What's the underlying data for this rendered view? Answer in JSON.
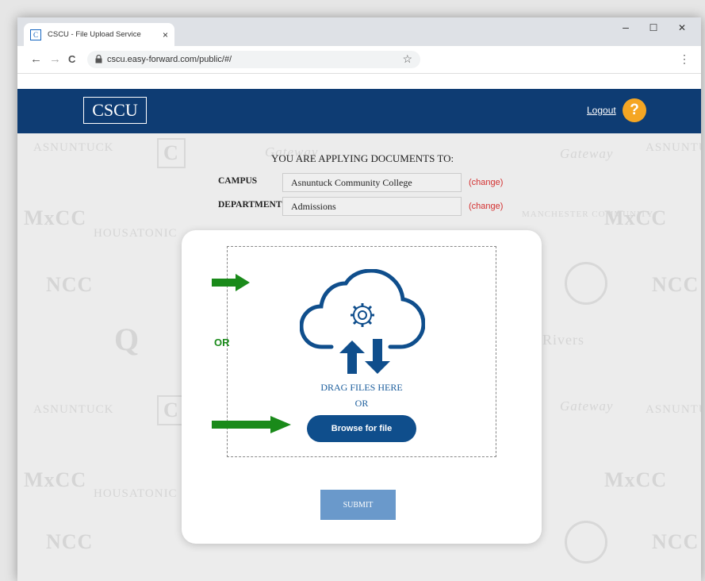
{
  "browser": {
    "tab_title": "CSCU - File Upload Service",
    "favicon_letter": "C",
    "tab_close": "×",
    "url": "cscu.easy-forward.com/public/#/",
    "minimize": "–",
    "maximize": "☐",
    "close": "✕",
    "back": "←",
    "forward": "→",
    "reload": "C",
    "bookmark": "☆",
    "menu": "⋮",
    "lock": "🔒"
  },
  "header": {
    "logo": "CSCU",
    "logout": "Logout",
    "help": "?"
  },
  "watermarks": [
    "ASNUNTUCK",
    "Gateway",
    "HOUSATONIC",
    "MANCHESTER COMMUNITY",
    "MxCC",
    "NCC",
    "Q",
    "Rivers",
    "CAPITAL"
  ],
  "applying": {
    "title": "YOU ARE APPLYING DOCUMENTS TO:",
    "campus_label": "CAMPUS",
    "campus_value": "Asnuntuck Community College",
    "department_label": "DEPARTMENT",
    "department_value": "Admissions",
    "change_label": "(change)"
  },
  "upload": {
    "drag_text": "DRAG FILES HERE",
    "or_text": "OR",
    "browse_label": "Browse for file",
    "submit_label": "SUBMIT"
  },
  "annotation": {
    "or_label": "OR",
    "arrow_color": "#1a8a1a"
  },
  "colors": {
    "header_bg": "#0e3c73",
    "accent": "#0f4e8c",
    "help_badge": "#f5a623",
    "change_link": "#d32f2f"
  }
}
